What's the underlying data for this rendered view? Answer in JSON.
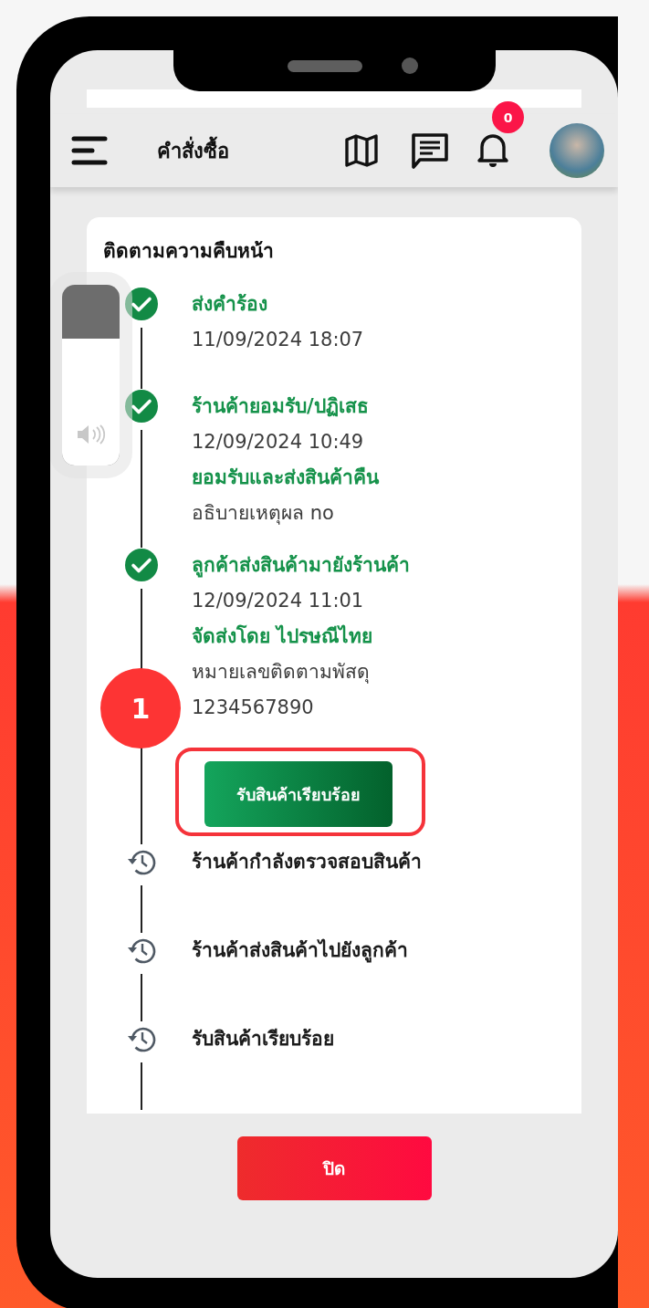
{
  "header": {
    "title": "คำสั่งซื้อ",
    "notification_count": "0"
  },
  "volume_hud": {
    "level": 0.7
  },
  "progress": {
    "title": "ติดตามความคืบหน้า",
    "steps": [
      {
        "kind": "done",
        "title": "ส่งคำร้อง",
        "details": [
          {
            "kind": "date",
            "text": "11/09/2024 18:07"
          }
        ]
      },
      {
        "kind": "done",
        "title": "ร้านค้ายอมรับ/ปฏิเสธ",
        "details": [
          {
            "kind": "date",
            "text": "12/09/2024 10:49"
          },
          {
            "kind": "highlight",
            "text": "ยอมรับและส่งสินค้าคืน"
          },
          {
            "kind": "note",
            "text": "อธิบายเหตุผล no"
          }
        ]
      },
      {
        "kind": "done",
        "title": "ลูกค้าส่งสินค้ามายังร้านค้า",
        "details": [
          {
            "kind": "date",
            "text": "12/09/2024 11:01"
          },
          {
            "kind": "highlight",
            "text": "จัดส่งโดย ไปรษณีไทย"
          },
          {
            "kind": "note",
            "text": "หมายเลขติดตามพัสดุ"
          },
          {
            "kind": "note",
            "text": "1234567890"
          }
        ],
        "action": {
          "label": "รับสินค้าเรียบร้อย",
          "highlighted": true,
          "step_badge": "1"
        }
      },
      {
        "kind": "pending",
        "title": "ร้านค้ากำลังตรวจสอบสินค้า"
      },
      {
        "kind": "pending",
        "title": "ร้านค้าส่งสินค้าไปยังลูกค้า"
      },
      {
        "kind": "pending",
        "title": "รับสินค้าเรียบร้อย"
      }
    ]
  },
  "close_button": "ปิด"
}
